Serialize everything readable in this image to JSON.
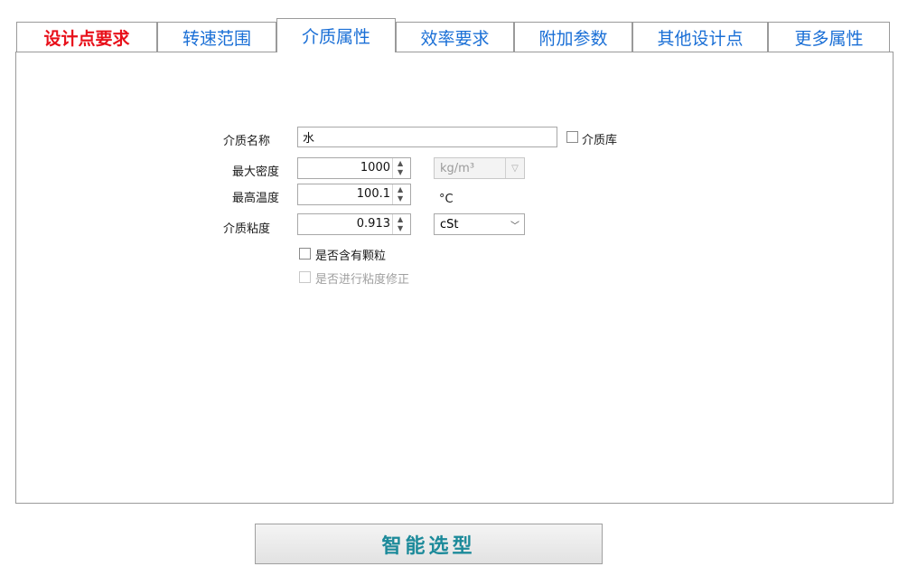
{
  "tabs": [
    {
      "label": "设计点要求"
    },
    {
      "label": "转速范围"
    },
    {
      "label": "介质属性"
    },
    {
      "label": "效率要求"
    },
    {
      "label": "附加参数"
    },
    {
      "label": "其他设计点"
    },
    {
      "label": "更多属性"
    }
  ],
  "active_tab": "介质属性",
  "form": {
    "medium_name": {
      "label": "介质名称",
      "value": "水"
    },
    "medium_library": {
      "label": "介质库",
      "checked": false
    },
    "max_density": {
      "label": "最大密度",
      "value": "1000",
      "unit": "kg/m³"
    },
    "max_temperature": {
      "label": "最高温度",
      "value": "100.1",
      "unit": "°C"
    },
    "viscosity": {
      "label": "介质粘度",
      "value": "0.913",
      "unit": "cSt"
    },
    "has_particles": {
      "label": "是否含有颗粒",
      "checked": false
    },
    "viscosity_correction": {
      "label": "是否进行粘度修正",
      "checked": false,
      "enabled": false
    }
  },
  "actions": {
    "smart_select": "智能选型"
  },
  "colors": {
    "tab_text": "#1a6fd6",
    "first_tab_text": "#e8101a",
    "button_text": "#1c8a9a",
    "border": "#9a9a9a"
  }
}
